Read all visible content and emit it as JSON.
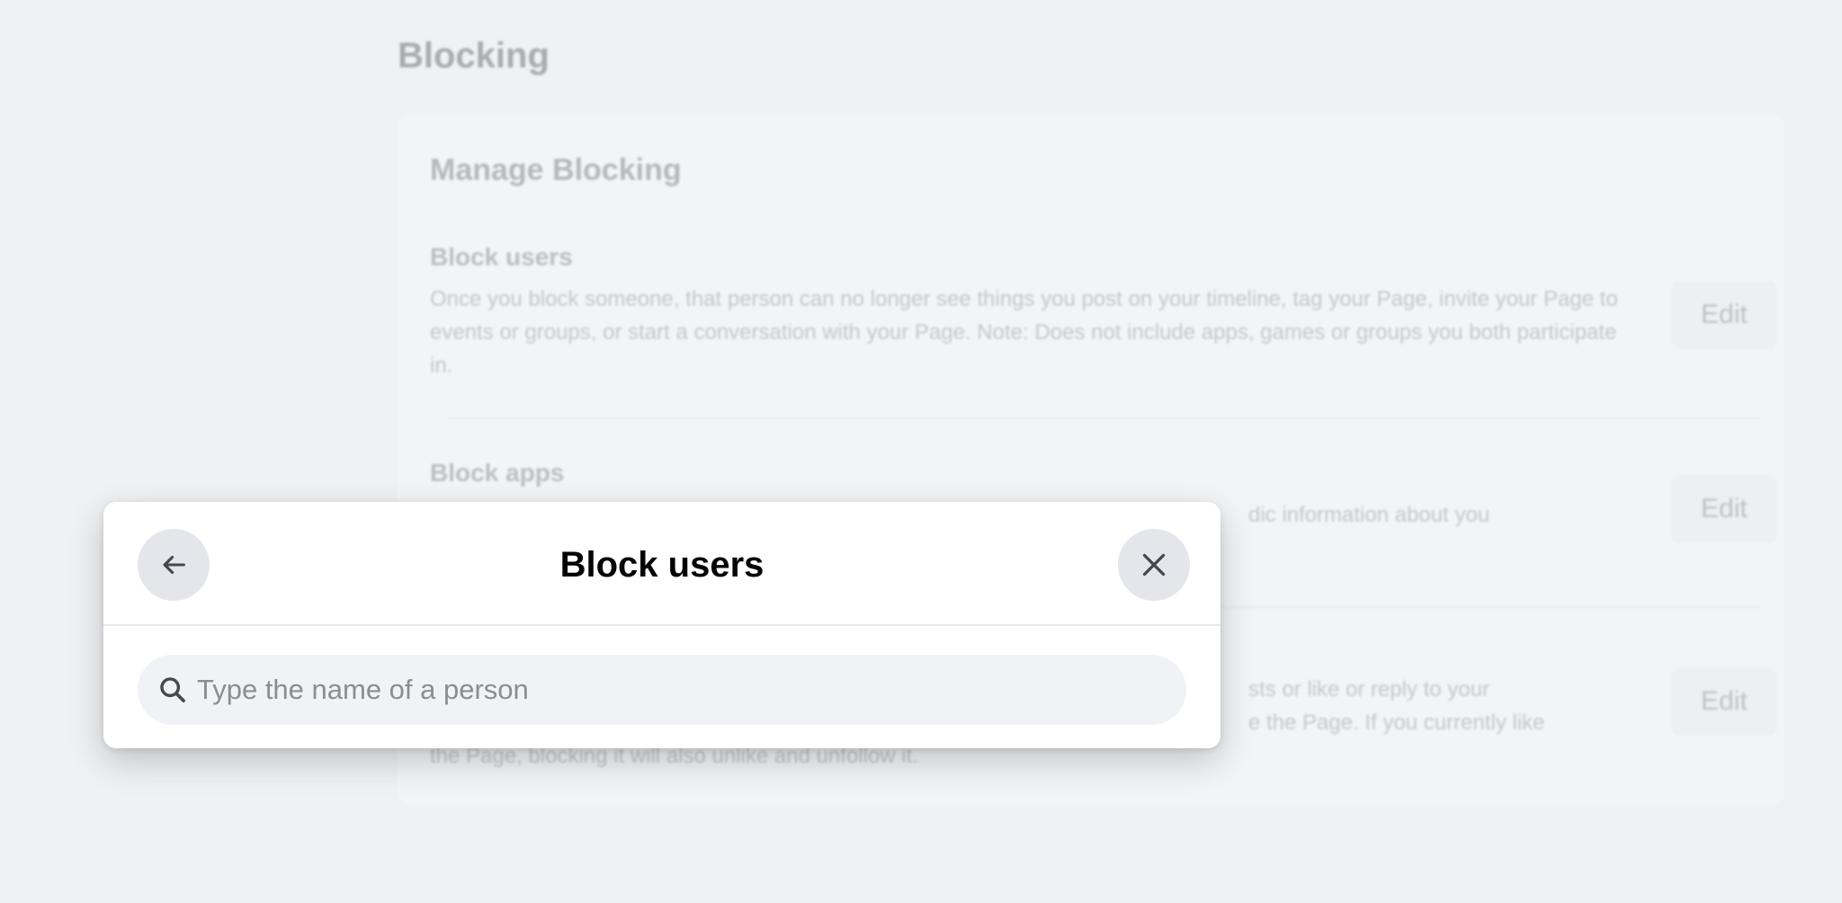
{
  "background": {
    "section_title": "Blocking",
    "card": {
      "title": "Manage Blocking",
      "rows": [
        {
          "title": "Block users",
          "description": "Once you block someone, that person can no longer see things you post on your timeline, tag your Page, invite your Page to events or groups, or start a conversation with your Page. Note: Does not include apps, games or groups you both participate in.",
          "edit_label": "Edit"
        },
        {
          "title": "Block apps",
          "description": "dic information about you",
          "edit_label": "Edit"
        },
        {
          "title": "",
          "description_line1": "sts or like or reply to your",
          "description_line2": "e the Page. If you currently like",
          "description_line3": "the Page, blocking it will also unlike and unfollow it.",
          "edit_label": "Edit"
        }
      ]
    }
  },
  "dialog": {
    "title": "Block users",
    "back_icon": "arrow-left-icon",
    "close_icon": "close-icon",
    "search": {
      "icon": "search-icon",
      "value": "",
      "placeholder": "Type the name of a person"
    }
  },
  "colors": {
    "page_bg": "#f0f1f3",
    "dialog_bg": "#ffffff",
    "button_circle": "#e4e6eb",
    "search_bg": "#f0f2f5",
    "title_text": "#050505",
    "placeholder_text": "#8a8d91"
  }
}
